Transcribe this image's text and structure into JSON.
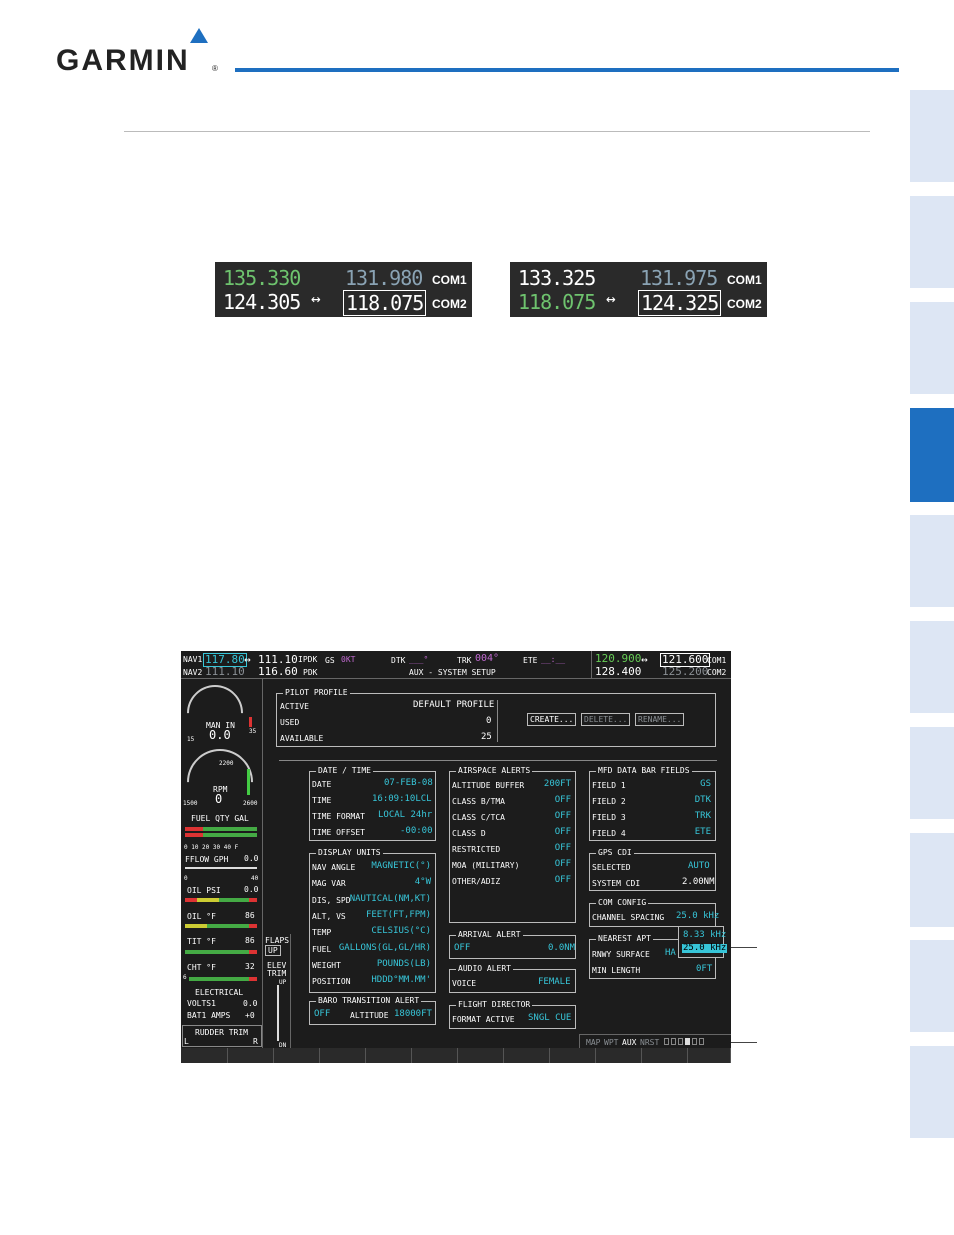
{
  "header": {
    "brand": "GARMIN",
    "registered": "®"
  },
  "com_left": {
    "com1_active": "135.330",
    "com1_standby": "131.980",
    "com1_label": "COM1",
    "com2_active": "124.305",
    "com2_standby": "118.075",
    "com2_label": "COM2",
    "swap": "↔"
  },
  "com_right": {
    "com1_active": "133.325",
    "com1_standby": "131.975",
    "com1_label": "COM1",
    "com2_active": "118.075",
    "com2_standby": "124.325",
    "com2_label": "COM2",
    "swap": "↔"
  },
  "mfd": {
    "nav1_label": "NAV1",
    "nav1_active": "117.80",
    "nav1_swap": "↔",
    "nav1_standby": "111.10",
    "nav1_id": "IPDK",
    "nav2_label": "NAV2",
    "nav2_active": "111.10",
    "nav2_standby": "116.60",
    "nav2_id": "PDK",
    "gs_label": "GS",
    "gs_value": "0KT",
    "dtk_label": "DTK",
    "dtk_value": "___°",
    "trk_label": "TRK",
    "trk_value": "004°",
    "ete_label": "ETE",
    "ete_value": "__:__",
    "page_title": "AUX - SYSTEM SETUP",
    "com1_active": "120.900",
    "com_swap": "↔",
    "com1_standby": "121.600",
    "com1_label": "COM1",
    "com2_active": "128.400",
    "com2_standby": "125.200",
    "com2_label": "COM2",
    "pilot_profile": {
      "title": "PILOT PROFILE",
      "active_label": "ACTIVE",
      "active_value": "DEFAULT PROFILE",
      "used_label": "USED",
      "used_value": "0",
      "available_label": "AVAILABLE",
      "available_value": "25",
      "create": "CREATE...",
      "delete": "DELETE...",
      "rename": "RENAME..."
    },
    "date_time": {
      "title": "DATE / TIME",
      "date_label": "DATE",
      "date_value": "07-FEB-08",
      "time_label": "TIME",
      "time_value": "16:09:10LCL",
      "format_label": "TIME FORMAT",
      "format_value": "LOCAL 24hr",
      "offset_label": "TIME OFFSET",
      "offset_value": "-00:00"
    },
    "display_units": {
      "title": "DISPLAY UNITS",
      "rows": [
        [
          "NAV ANGLE",
          "MAGNETIC(°)"
        ],
        [
          "MAG VAR",
          "4°W"
        ],
        [
          "DIS, SPD",
          "NAUTICAL(NM,KT)"
        ],
        [
          "ALT, VS",
          "FEET(FT,FPM)"
        ],
        [
          "TEMP",
          "CELSIUS(°C)"
        ],
        [
          "FUEL",
          "GALLONS(GL,GL/HR)"
        ],
        [
          "WEIGHT",
          "POUNDS(LB)"
        ],
        [
          "POSITION",
          "HDDD°MM.MM'"
        ]
      ]
    },
    "baro": {
      "title": "BARO TRANSITION ALERT",
      "state": "OFF",
      "altitude_label": "ALTITUDE",
      "altitude_value": "18000FT"
    },
    "airspace": {
      "title": "AIRSPACE ALERTS",
      "rows": [
        [
          "ALTITUDE BUFFER",
          "200FT"
        ],
        [
          "CLASS B/TMA",
          "OFF"
        ],
        [
          "CLASS C/TCA",
          "OFF"
        ],
        [
          "CLASS D",
          "OFF"
        ],
        [
          "RESTRICTED",
          "OFF"
        ],
        [
          "MOA (MILITARY)",
          "OFF"
        ],
        [
          "OTHER/ADIZ",
          "OFF"
        ]
      ]
    },
    "arrival": {
      "title": "ARRIVAL ALERT",
      "state": "OFF",
      "value": "0.0NM"
    },
    "audio": {
      "title": "AUDIO ALERT",
      "voice_label": "VOICE",
      "voice_value": "FEMALE"
    },
    "flight_director": {
      "title": "FLIGHT DIRECTOR",
      "format_label": "FORMAT ACTIVE",
      "format_value": "SNGL CUE"
    },
    "data_bar": {
      "title": "MFD DATA BAR FIELDS",
      "rows": [
        [
          "FIELD 1",
          "GS"
        ],
        [
          "FIELD 2",
          "DTK"
        ],
        [
          "FIELD 3",
          "TRK"
        ],
        [
          "FIELD 4",
          "ETE"
        ]
      ]
    },
    "gps_cdi": {
      "title": "GPS CDI",
      "selected_label": "SELECTED",
      "selected_value": "AUTO",
      "system_label": "SYSTEM CDI",
      "system_value": "2.00NM"
    },
    "com_config": {
      "title": "COM CONFIG",
      "spacing_label": "CHANNEL SPACING",
      "spacing_value": "25.0 kHz"
    },
    "nearest_apt": {
      "title": "NEAREST APT",
      "surface_label": "RNWY SURFACE",
      "surface_value": "HA",
      "min_label": "MIN LENGTH",
      "min_value": "0FT"
    },
    "spacing_options": [
      "8.33 kHz",
      "25.0 kHz"
    ],
    "page_group": {
      "labels": [
        "MAP",
        "WPT",
        "AUX",
        "NRST"
      ]
    },
    "eis": {
      "man_in_label": "MAN IN",
      "man_in_value": "0.0",
      "man_min": "15",
      "man_max": "35",
      "rpm_label": "RPM",
      "rpm_value": "0",
      "rpm_mark": "2200",
      "rpm_min": "1500",
      "rpm_max": "2600",
      "fuel_label": "FUEL QTY GAL",
      "fuel_ticks": "0  10  20  30  40 F",
      "fflow_label": "FFLOW GPH",
      "fflow_value": "0.0",
      "fflow_min": "0",
      "fflow_max": "40",
      "oil_psi_label": "OIL PSI",
      "oil_psi_value": "0.0",
      "oil_f_label": "OIL °F",
      "oil_f_value": "86",
      "tit_label": "TIT °F",
      "tit_value": "86",
      "cht_label": "CHT °F",
      "cht_value": "32",
      "cht_cyl": "6",
      "electrical": "ELECTRICAL",
      "volts_label": "VOLTS1",
      "volts_value": "0.0",
      "amps_label": "BAT1 AMPS",
      "amps_value": "+0",
      "rudder_label": "RUDDER TRIM",
      "rudder_l": "L",
      "rudder_r": "R",
      "flaps_label": "FLAPS",
      "flaps_value": "UP",
      "elev_label": "ELEV",
      "trim_label": "TRIM",
      "trim_up": "UP",
      "trim_dn": "DN"
    }
  }
}
